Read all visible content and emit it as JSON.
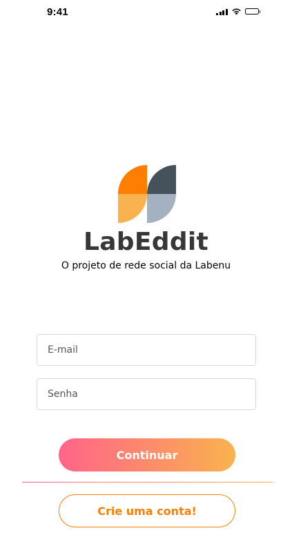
{
  "status_bar": {
    "time": "9:41",
    "icons": [
      "cellular-signal-icon",
      "wifi-icon",
      "battery-icon"
    ]
  },
  "logo": {
    "icon": "labeddit-logo-icon",
    "colors": [
      "#fe7e02",
      "#f9b24e",
      "#45525b",
      "#a3b1c0"
    ]
  },
  "app": {
    "title": "LabEddit",
    "tagline": "O projeto de rede social da Labenu"
  },
  "form": {
    "email_placeholder": "E-mail",
    "email_value": "",
    "password_placeholder": "Senha",
    "password_value": ""
  },
  "actions": {
    "continue_label": "Continuar",
    "signup_label": "Crie uma conta!"
  },
  "colors": {
    "gradient_start": "#ff6489",
    "gradient_end": "#f9b24e",
    "accent_orange": "#fe7e02",
    "title_text": "#373737"
  }
}
